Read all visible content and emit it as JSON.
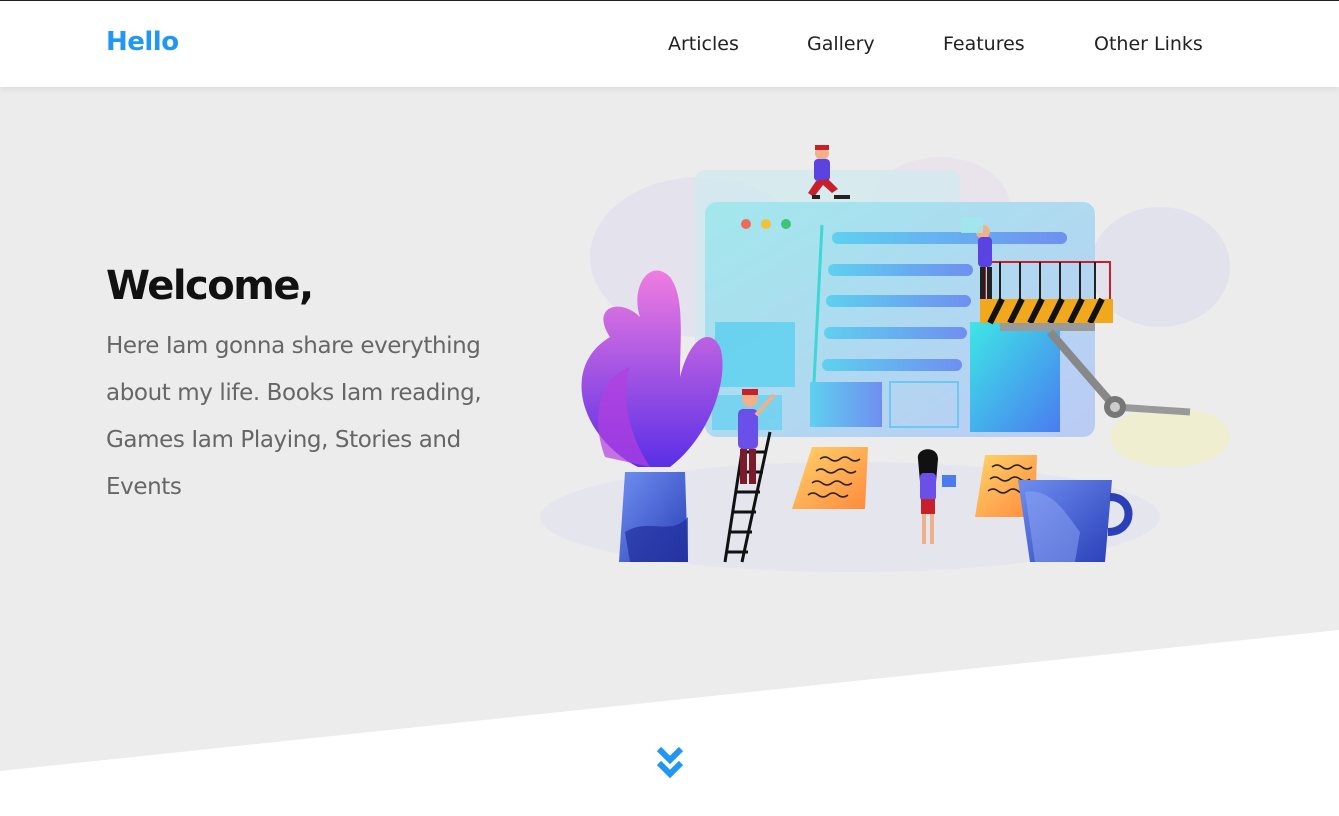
{
  "nav": {
    "brand": "Hello",
    "links": [
      {
        "label": "Articles"
      },
      {
        "label": "Gallery"
      },
      {
        "label": "Features"
      },
      {
        "label": "Other Links"
      }
    ]
  },
  "hero": {
    "title": "Welcome,",
    "text": "Here Iam gonna share everything about my life. Books Iam reading, Games Iam Playing, Stories and Events"
  },
  "icons": {
    "scroll_down": "chevron-double-down-icon"
  },
  "colors": {
    "accent": "#2196f3",
    "hero_background": "#ececec",
    "text_dark": "#111111",
    "text_muted": "#666666"
  }
}
